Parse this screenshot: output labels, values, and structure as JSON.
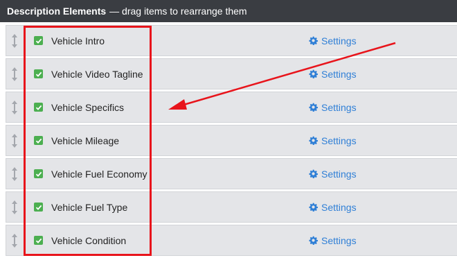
{
  "header": {
    "title": "Description Elements",
    "subtitle": "— drag items to rearrange them"
  },
  "colors": {
    "header_bg": "#3a3d42",
    "row_bg": "#e4e5e8",
    "checkbox": "#4caf50",
    "link": "#2f7fd6",
    "annotation": "#e8141b"
  },
  "items": [
    {
      "label": "Vehicle Intro",
      "checked": true,
      "settings_label": "Settings"
    },
    {
      "label": "Vehicle Video Tagline",
      "checked": true,
      "settings_label": "Settings"
    },
    {
      "label": "Vehicle Specifics",
      "checked": true,
      "settings_label": "Settings"
    },
    {
      "label": "Vehicle Mileage",
      "checked": true,
      "settings_label": "Settings"
    },
    {
      "label": "Vehicle Fuel Economy",
      "checked": true,
      "settings_label": "Settings"
    },
    {
      "label": "Vehicle Fuel Type",
      "checked": true,
      "settings_label": "Settings"
    },
    {
      "label": "Vehicle Condition",
      "checked": true,
      "settings_label": "Settings"
    }
  ],
  "icons": {
    "drag": "drag-handle-icon",
    "check": "checkmark-icon",
    "settings": "gear-icon"
  }
}
